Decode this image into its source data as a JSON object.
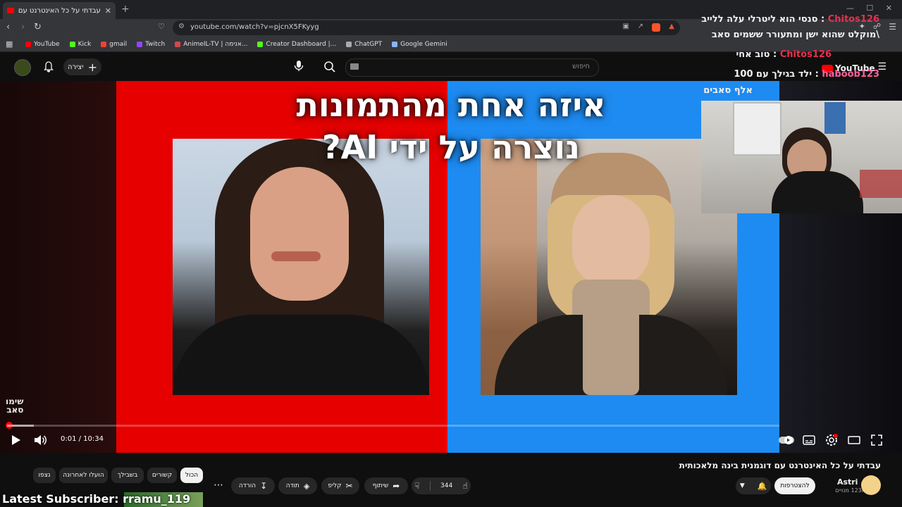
{
  "browser": {
    "tab_title": "עבדתי על כל האינטרנט עם דוגמ...",
    "new_tab": "+",
    "url": "youtube.com/watch?v=pjcnX5FKyyg",
    "bookmarks": [
      {
        "label": "YouTube",
        "color": "#ff0000"
      },
      {
        "label": "Kick",
        "color": "#53fc18"
      },
      {
        "label": "gmail",
        "color": "#ea4335"
      },
      {
        "label": "Twitch",
        "color": "#9146ff"
      },
      {
        "label": "AnimeIL-TV | אנימה...",
        "color": "#d04a4a"
      },
      {
        "label": "Creator Dashboard |...",
        "color": "#53fc18"
      },
      {
        "label": "ChatGPT",
        "color": "#aaaaaa"
      },
      {
        "label": "Google Gemini",
        "color": "#8ab4f8"
      }
    ]
  },
  "header": {
    "search_placeholder": "חיפוש",
    "create_label": "יצירה",
    "logo_text": "YouTube"
  },
  "video": {
    "title_overlay_line1": "איזה אחת מהתמונות",
    "title_overlay_line2": "נוצרה על ידי AI?",
    "watermark_line1": "שימו",
    "watermark_line2": "סאב",
    "time": "0:01 / 10:34",
    "progress_fraction": 0.003
  },
  "stream_overlay": {
    "chat": [
      {
        "user": "Chitos126",
        "msg": "סנסי הוא ליטרלי עלה ללייב"
      },
      {
        "user": "",
        "msg": "\\מוקלט שהוא ישן ומתעורר ששמים סאב"
      },
      {
        "user": "Chitos126",
        "msg": "טוב אחי"
      },
      {
        "user": "haboob123",
        "msg": "ילד בגילך עם 100"
      },
      {
        "user": "",
        "msg": "אלף סאבים"
      }
    ],
    "latest_subscriber": "Latest Subscriber: rramu_119"
  },
  "below": {
    "video_title": "עבדתי על כל האינטרנט עם דוגמנית בינה מלאכותית",
    "channel_name": "Astri",
    "subscribers": "123K מנויים",
    "subscribe_label": "להצטרפות",
    "like_count": "344",
    "actions": {
      "share": "שיתוף",
      "clip": "קליפ",
      "thanks": "תודה",
      "download": "הורדה"
    },
    "chips": [
      "הכול",
      "קשורים",
      "בשבילך",
      "הועלו לאחרונה",
      "נצפו"
    ]
  }
}
